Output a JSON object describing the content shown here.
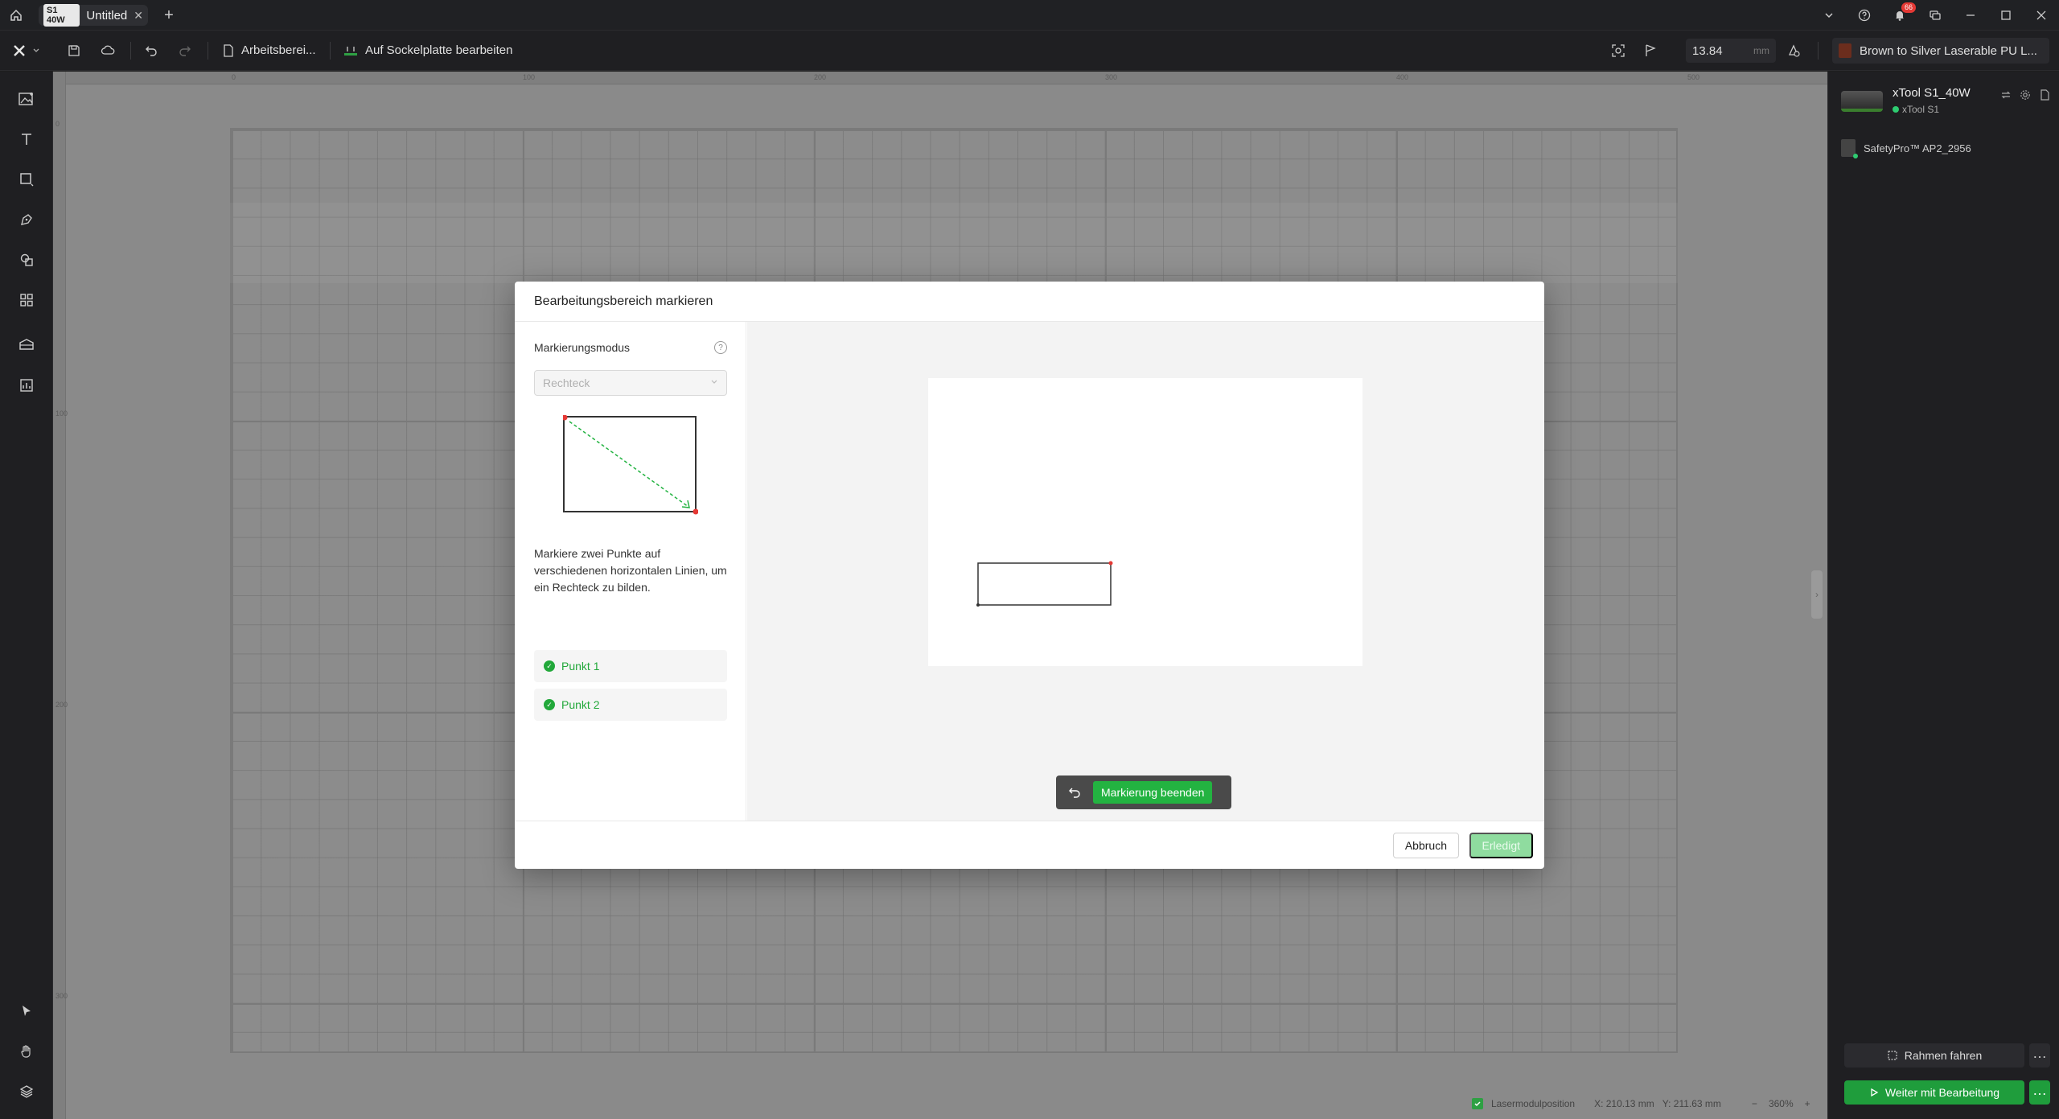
{
  "titlebar": {
    "tab_badge": "S1 40W",
    "tab_title": "Untitled",
    "notification_count": "66"
  },
  "toolbar": {
    "workspace_label": "Arbeitsberei...",
    "edit_base_label": "Auf Sockelplatte bearbeiten",
    "thickness_value": "13.84",
    "thickness_unit": "mm",
    "material_name": "Brown to Silver Laserable PU L..."
  },
  "ruler": {
    "top_ticks": [
      "0",
      "100",
      "200",
      "300",
      "400",
      "500"
    ],
    "left_ticks": [
      "0",
      "100",
      "200",
      "300"
    ]
  },
  "device": {
    "name": "xTool S1_40W",
    "model": "xTool S1",
    "accessory": "SafetyPro™ AP2_2956"
  },
  "right_actions": {
    "frame_label": "Rahmen fahren",
    "continue_label": "Weiter mit Bearbeitung"
  },
  "statusbar": {
    "laser_position_label": "Lasermodulposition",
    "x_readout": "X: 210.13 mm",
    "y_readout": "Y: 211.63 mm",
    "zoom": "360%"
  },
  "modal": {
    "title": "Bearbeitungsbereich markieren",
    "mode_label": "Markierungsmodus",
    "mode_value": "Rechteck",
    "instruction": "Markiere zwei Punkte auf verschiedenen horizontalen Linien, um ein Rechteck zu bilden.",
    "points": [
      {
        "label": "Punkt 1"
      },
      {
        "label": "Punkt 2"
      }
    ],
    "end_marking_label": "Markierung beenden",
    "cancel_label": "Abbruch",
    "done_label": "Erledigt"
  },
  "colors": {
    "accent_green": "#23b341",
    "marker_red": "#e53935"
  }
}
